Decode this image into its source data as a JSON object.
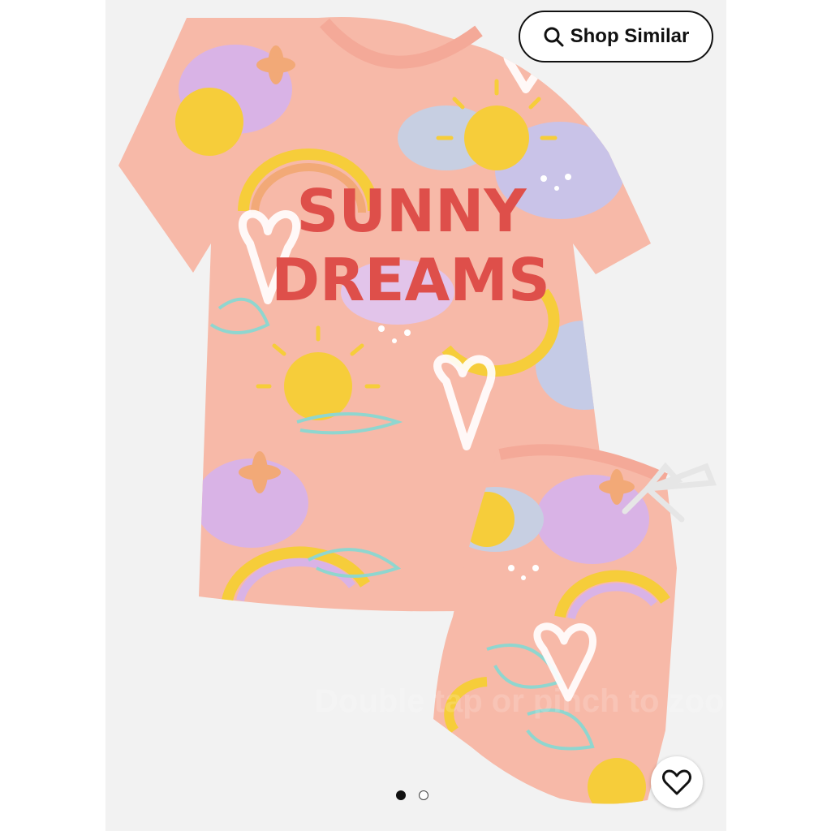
{
  "product": {
    "print_text_line1": "SUNNY",
    "print_text_line2": "DREAMS"
  },
  "shop_similar": {
    "label": "Shop Similar",
    "icon": "search-icon"
  },
  "gallery": {
    "hint": "Double tap or pinch to zoom",
    "total_images": 2,
    "active_index": 1
  },
  "favorite": {
    "icon": "heart-outline-icon"
  },
  "colors": {
    "fabric_pink": "#f7b9a8",
    "sun_yellow": "#f6cd3a",
    "lilac": "#d9b3e6",
    "mint": "#8fd6cf",
    "glitter_red": "#de4f4a"
  }
}
